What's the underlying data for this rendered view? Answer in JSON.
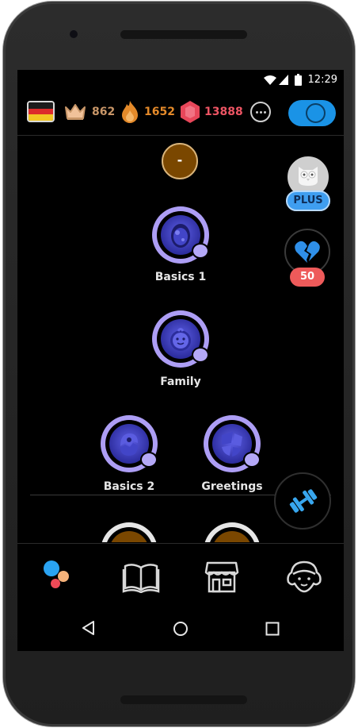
{
  "status_bar": {
    "time": "12:29"
  },
  "top_bar": {
    "crowns": "862",
    "streak": "1652",
    "gems": "13888"
  },
  "colors": {
    "crown": "#c89668",
    "streak": "#e48a2a",
    "gems": "#ee5564",
    "toggle": "#1a93e6",
    "skill_ring": "#ad9ef5"
  },
  "checkpoint_badge": "-",
  "skills": [
    {
      "label": "Basics 1",
      "icon": "egg-icon"
    },
    {
      "label": "Family",
      "icon": "baby-icon"
    },
    {
      "label": "Basics 2",
      "icon": "hatching-icon"
    },
    {
      "label": "Greetings",
      "icon": "cracked-shield-icon"
    }
  ],
  "side": {
    "plus_label": "PLUS",
    "hearts_label": "50"
  },
  "bottom_nav": [
    "learn-tab",
    "stories-tab",
    "shop-tab",
    "profile-tab"
  ]
}
